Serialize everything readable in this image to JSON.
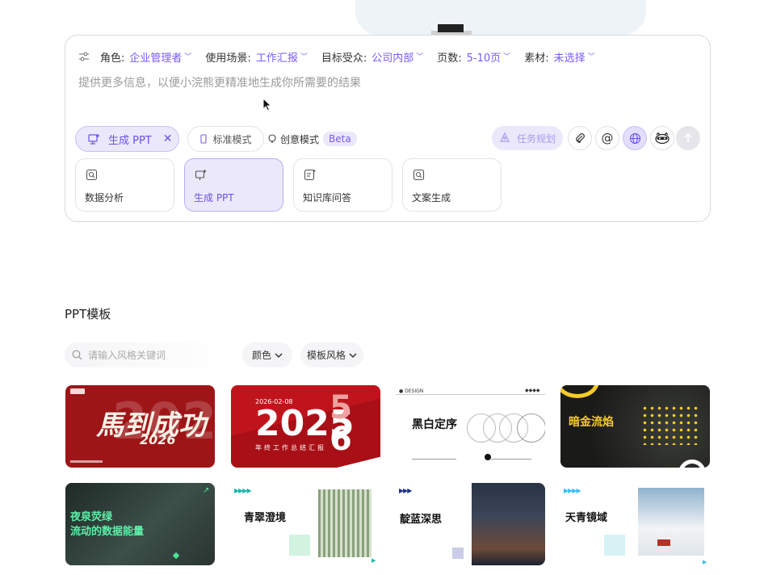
{
  "prompt": {
    "params": [
      {
        "label": "角色:",
        "value": "企业管理者"
      },
      {
        "label": "使用场景:",
        "value": "工作汇报"
      },
      {
        "label": "目标受众:",
        "value": "公司内部"
      },
      {
        "label": "页数:",
        "value": "5-10页"
      },
      {
        "label": "素材:",
        "value": "未选择"
      }
    ],
    "placeholder": "提供更多信息，以便小浣熊更精准地生成你所需要的结果",
    "mode_chip": "生成 PPT",
    "standard_mode": "标准模式",
    "creative_mode": "创意模式",
    "beta_badge": "Beta",
    "task_plan": "任务规划",
    "quick_actions": [
      "数据分析",
      "生成 PPT",
      "知识库问答",
      "文案生成"
    ]
  },
  "templates_section": {
    "title": "PPT模板",
    "search_placeholder": "请输入风格关键词",
    "filters": [
      "颜色",
      "模板风格"
    ],
    "cards": [
      {
        "text": "馬到成功",
        "sub": "2026"
      },
      {
        "text": "2025",
        "sub": "6",
        "caption": "年终工作总结汇报",
        "date": "2026-02-08"
      },
      {
        "text": "黑白定序"
      },
      {
        "text": "暗金流焰"
      },
      {
        "text": "夜泉荧绿",
        "text2": "流动的数据能量"
      },
      {
        "text": "青翠澄境"
      },
      {
        "text": "靛蓝深思"
      },
      {
        "text": "天青镜域"
      }
    ]
  },
  "colors": {
    "accent": "#7a5af8",
    "accent_bg": "#ebe8fb"
  }
}
